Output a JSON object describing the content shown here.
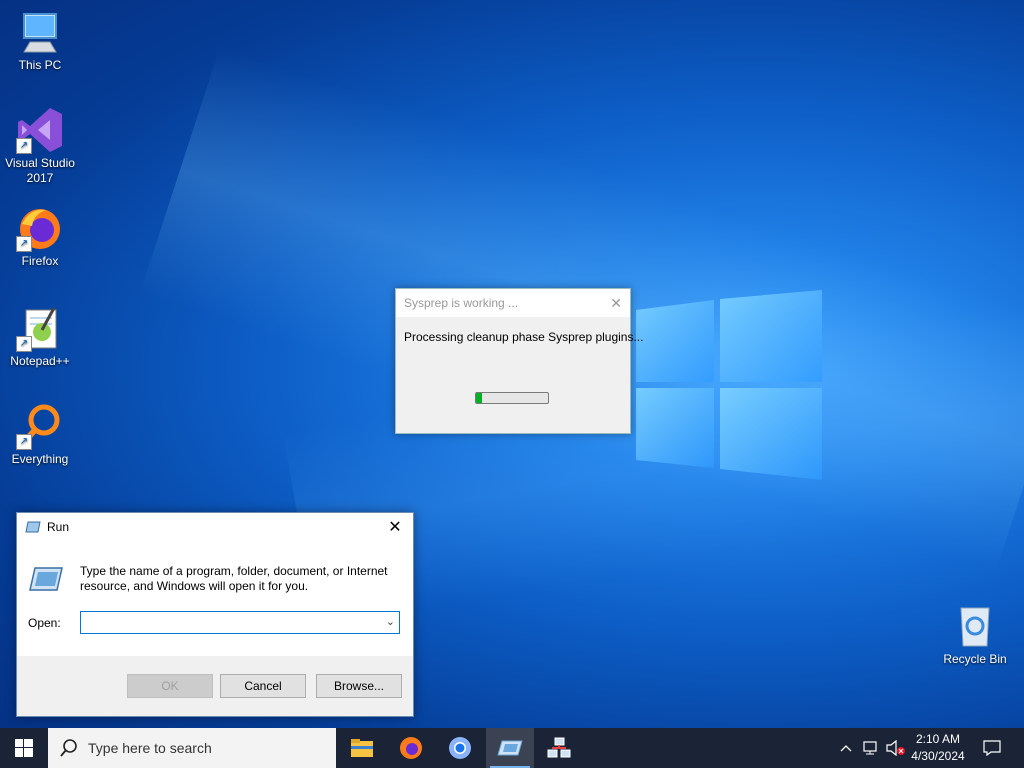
{
  "desktop": {
    "icons": [
      {
        "label": "This PC",
        "icon": "this-pc-icon"
      },
      {
        "label": "Visual Studio\n2017",
        "icon": "visual-studio-icon"
      },
      {
        "label": "Firefox",
        "icon": "firefox-icon"
      },
      {
        "label": "Notepad++",
        "icon": "notepad-plus-plus-icon"
      },
      {
        "label": "Everything",
        "icon": "everything-icon"
      },
      {
        "label": "Recycle Bin",
        "icon": "recycle-bin-icon"
      }
    ]
  },
  "sysprep_dialog": {
    "title": "Sysprep is working ...",
    "message": "Processing cleanup phase Sysprep plugins...",
    "progress_percent": 8
  },
  "run_dialog": {
    "title": "Run",
    "description": "Type the name of a program, folder, document, or Internet resource, and Windows will open it for you.",
    "open_label": "Open:",
    "open_value": "",
    "ok_label": "OK",
    "cancel_label": "Cancel",
    "browse_label": "Browse..."
  },
  "taskbar": {
    "search_placeholder": "Type here to search",
    "apps": [
      "file-explorer-icon",
      "firefox-icon",
      "chrome-icon",
      "run-icon",
      "network-icon"
    ],
    "clock_time": "2:10 AM",
    "clock_date": "4/30/2024"
  },
  "colors": {
    "accent": "#0078d7",
    "taskbar": "#1b2436",
    "progress": "#06b025"
  }
}
